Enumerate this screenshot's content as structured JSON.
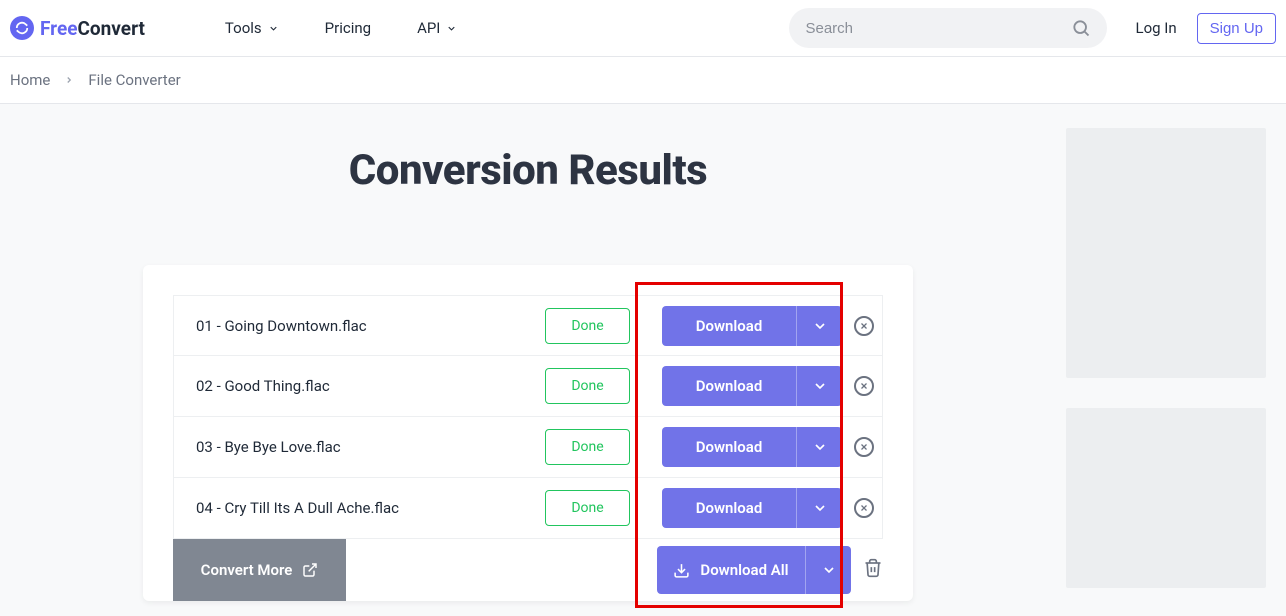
{
  "header": {
    "logo_free": "Free",
    "logo_convert": "Convert",
    "nav": {
      "tools": "Tools",
      "pricing": "Pricing",
      "api": "API"
    },
    "search_placeholder": "Search",
    "login": "Log In",
    "signup": "Sign Up"
  },
  "breadcrumb": {
    "home": "Home",
    "file_converter": "File Converter"
  },
  "main": {
    "title": "Conversion Results",
    "done_label": "Done",
    "download_label": "Download",
    "files": [
      {
        "name": "01 - Going Downtown.flac"
      },
      {
        "name": "02 - Good Thing.flac"
      },
      {
        "name": "03 - Bye Bye Love.flac"
      },
      {
        "name": "04 - Cry Till Its A Dull Ache.flac"
      }
    ],
    "convert_more": "Convert More",
    "download_all": "Download All"
  }
}
